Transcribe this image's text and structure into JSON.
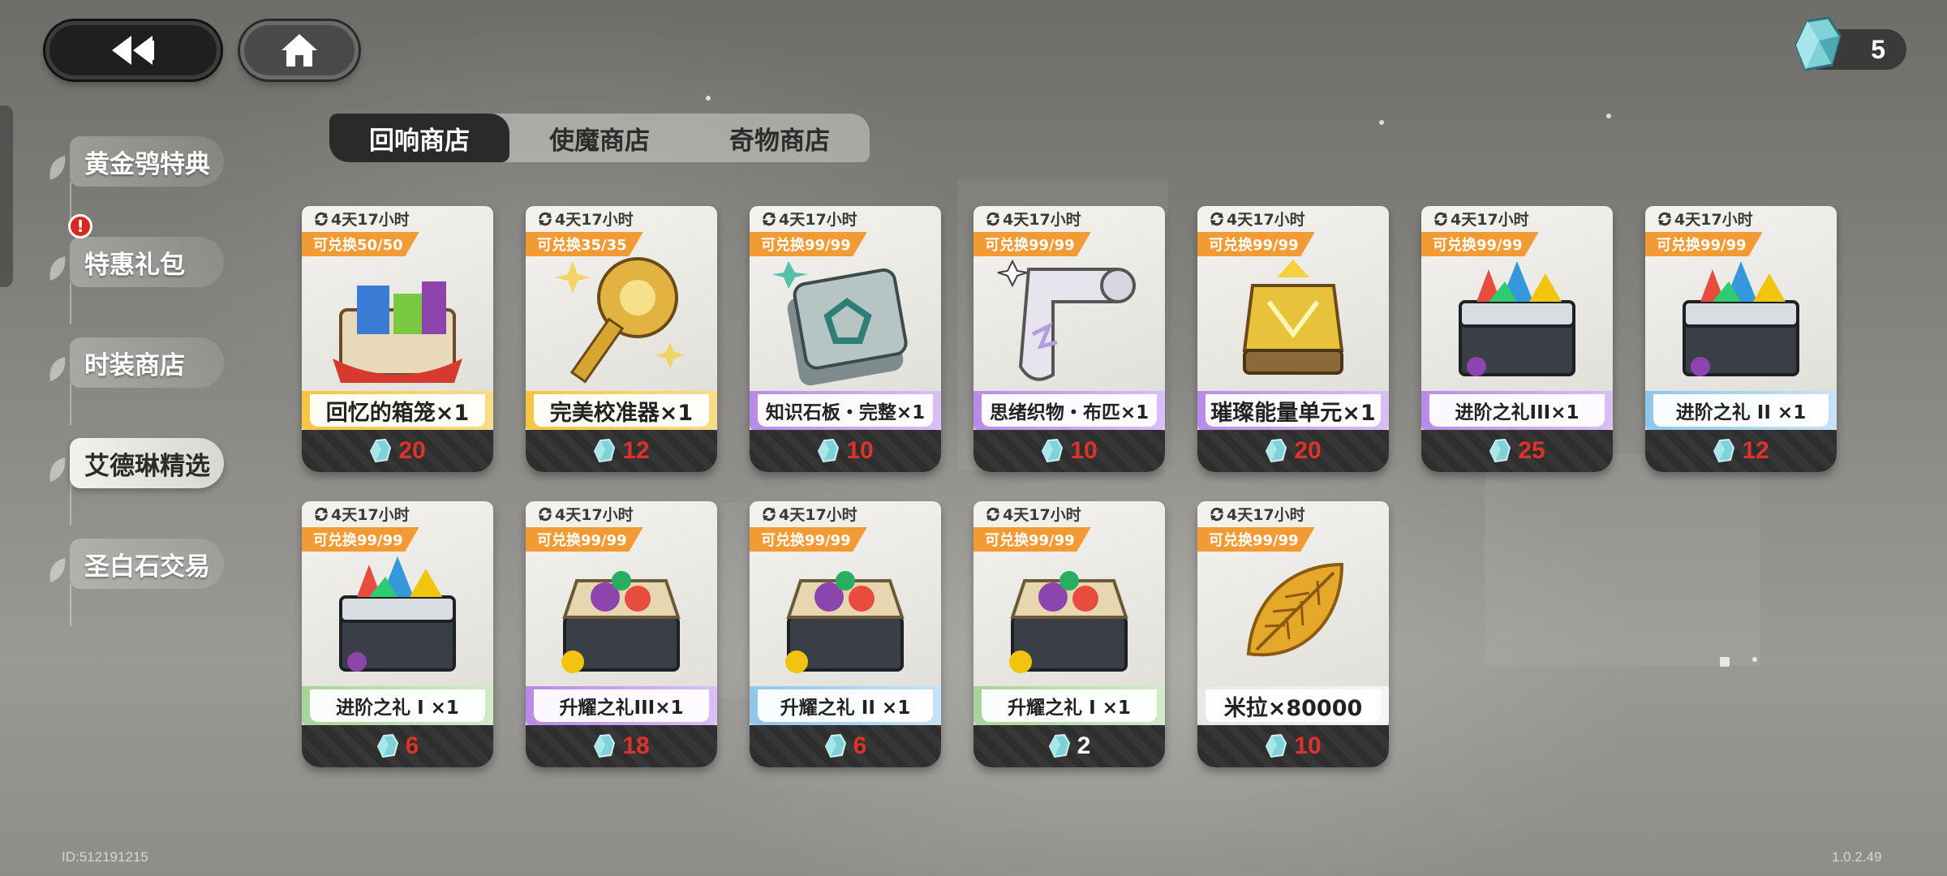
{
  "header": {
    "back_icon": "double-chevron-left-icon",
    "home_icon": "home-icon",
    "currency": {
      "icon": "crystal-icon",
      "value": "5"
    }
  },
  "sidebar": {
    "items": [
      {
        "label": "黄金鸮特典",
        "active": false
      },
      {
        "label": "特惠礼包",
        "active": false,
        "alert": "!"
      },
      {
        "label": "时装商店",
        "active": false
      },
      {
        "label": "艾德琳精选",
        "active": true
      },
      {
        "label": "圣白石交易",
        "active": false
      }
    ]
  },
  "tabs": [
    {
      "label": "回响商店",
      "active": true
    },
    {
      "label": "使魔商店",
      "active": false
    },
    {
      "label": "奇物商店",
      "active": false
    }
  ],
  "items": [
    {
      "timer": "4天17小时",
      "limit": "可兑换50/50",
      "name": "回忆的箱笼×1",
      "price": "20",
      "rarity": "yellow",
      "icon": "memory-chest-icon"
    },
    {
      "timer": "4天17小时",
      "limit": "可兑换35/35",
      "name": "完美校准器×1",
      "price": "12",
      "rarity": "yellow",
      "icon": "golden-key-icon"
    },
    {
      "timer": "4天17小时",
      "limit": "可兑换99/99",
      "name": "知识石板・完整×1",
      "price": "10",
      "rarity": "purple",
      "icon": "stone-tablet-icon"
    },
    {
      "timer": "4天17小时",
      "limit": "可兑换99/99",
      "name": "思绪织物・布匹×1",
      "price": "10",
      "rarity": "purple",
      "icon": "fabric-scroll-icon"
    },
    {
      "timer": "4天17小时",
      "limit": "可兑换99/99",
      "name": "璀璨能量单元×1",
      "price": "20",
      "rarity": "purple",
      "icon": "energy-lantern-icon"
    },
    {
      "timer": "4天17小时",
      "limit": "可兑换99/99",
      "name": "进阶之礼III×1",
      "price": "25",
      "rarity": "purple",
      "icon": "gem-chest-icon"
    },
    {
      "timer": "4天17小时",
      "limit": "可兑换99/99",
      "name": "进阶之礼 II ×1",
      "price": "12",
      "rarity": "blue",
      "icon": "gem-chest-icon"
    },
    {
      "timer": "4天17小时",
      "limit": "可兑换99/99",
      "name": "进阶之礼 I ×1",
      "price": "6",
      "rarity": "green",
      "icon": "gem-chest-icon"
    },
    {
      "timer": "4天17小时",
      "limit": "可兑换99/99",
      "name": "升耀之礼III×1",
      "price": "18",
      "rarity": "purple",
      "icon": "orb-chest-icon"
    },
    {
      "timer": "4天17小时",
      "limit": "可兑换99/99",
      "name": "升耀之礼 II ×1",
      "price": "6",
      "rarity": "blue",
      "icon": "orb-chest-icon"
    },
    {
      "timer": "4天17小时",
      "limit": "可兑换99/99",
      "name": "升耀之礼 I ×1",
      "price": "2",
      "rarity": "green",
      "icon": "orb-chest-icon"
    },
    {
      "timer": "4天17小时",
      "limit": "可兑换99/99",
      "name": "米拉×80000",
      "price": "10",
      "rarity": "white",
      "icon": "golden-leaf-icon"
    }
  ],
  "footer": {
    "id": "ID:512191215",
    "version": "1.0.2.49"
  },
  "colors": {
    "price_red": "#e0322a",
    "limit_orange": "#f29a33",
    "tab_active": "#2a2a2a"
  }
}
